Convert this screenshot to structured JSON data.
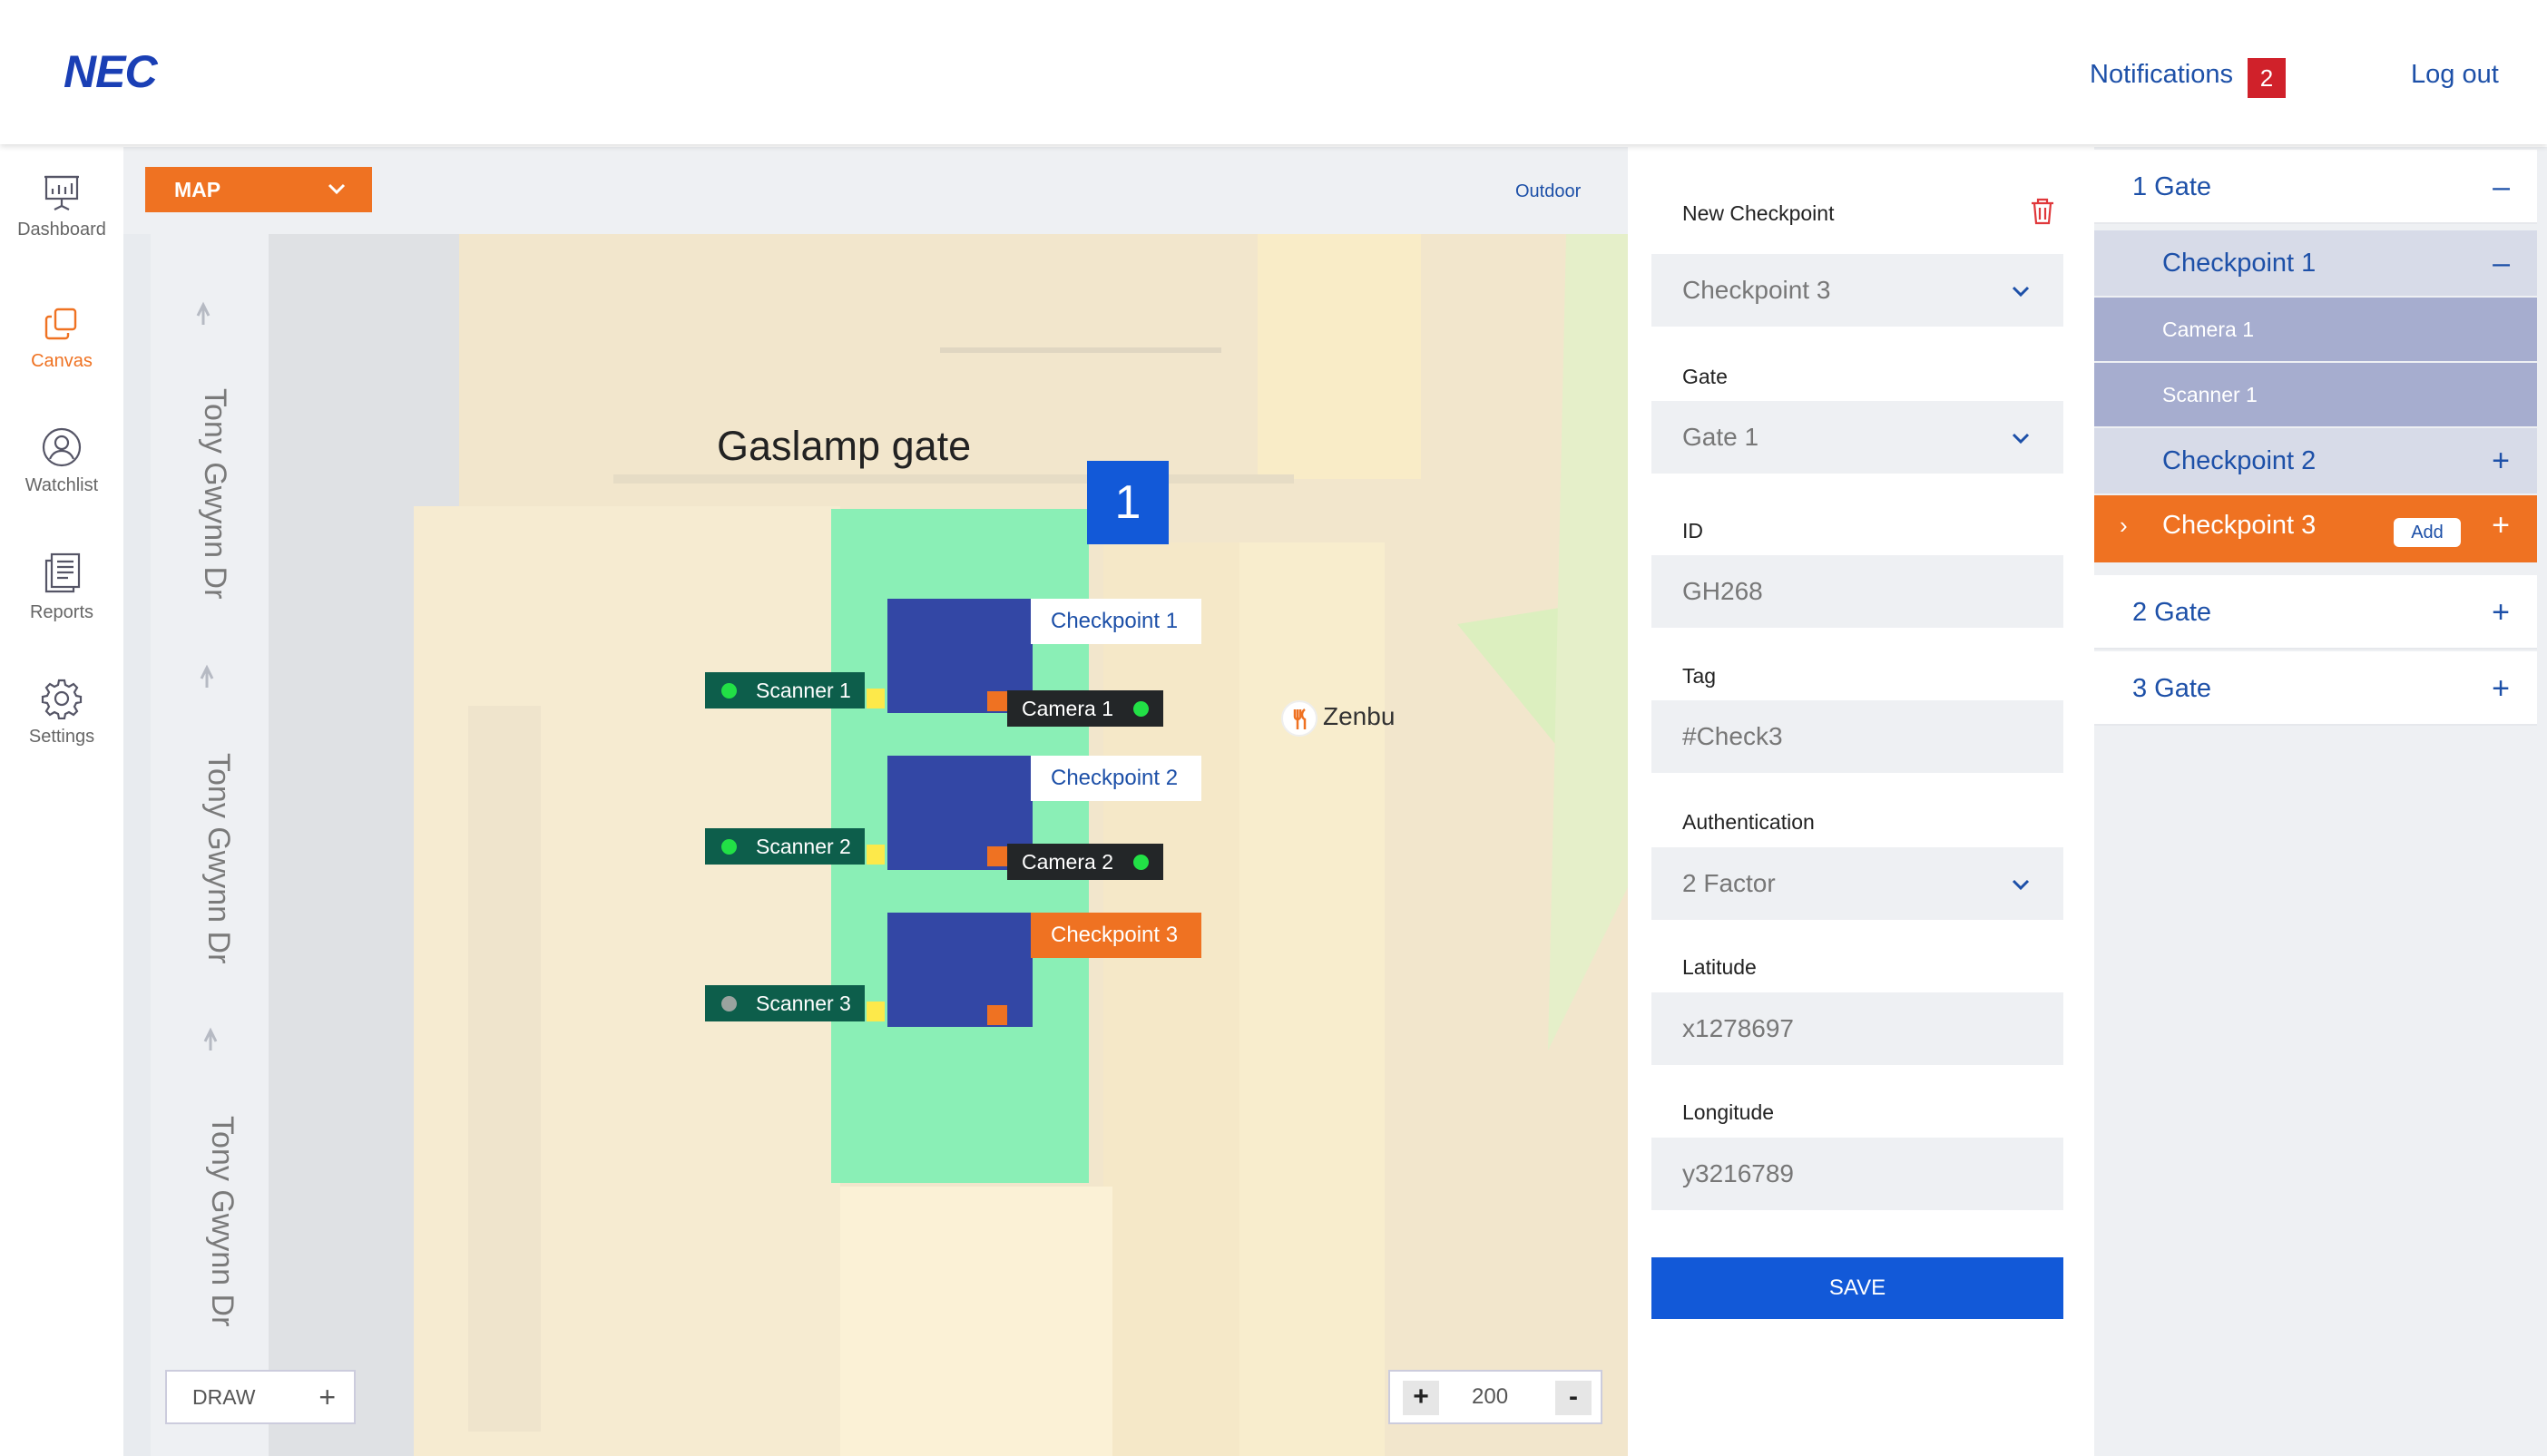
{
  "header": {
    "logo": "NEC",
    "notifications_label": "Notifications",
    "notifications_count": "2",
    "logout_label": "Log out"
  },
  "sidebar": {
    "items": [
      {
        "label": "Dashboard",
        "icon": "presentation-icon"
      },
      {
        "label": "Canvas",
        "icon": "canvas-icon"
      },
      {
        "label": "Watchlist",
        "icon": "user-icon"
      },
      {
        "label": "Reports",
        "icon": "reports-icon"
      },
      {
        "label": "Settings",
        "icon": "gear-icon"
      }
    ],
    "active": "Canvas"
  },
  "map_toolbar": {
    "view_select": "MAP",
    "view_mode": "Outdoor"
  },
  "map": {
    "road_label": "Tony Gwynn Dr",
    "gate_title": "Gaslamp gate",
    "gate_number": "1",
    "poi": "Zenbu",
    "checkpoints": [
      "Checkpoint 1",
      "Checkpoint 2",
      "Checkpoint 3"
    ],
    "scanners": [
      "Scanner 1",
      "Scanner 2",
      "Scanner 3"
    ],
    "cameras": [
      "Camera 1",
      "Camera 2"
    ],
    "draw_label": "DRAW",
    "zoom": "200",
    "zoom_in": "+",
    "zoom_out": "-"
  },
  "form": {
    "title": "New Checkpoint",
    "checkpoint": "Checkpoint 3",
    "gate_label": "Gate",
    "gate_value": "Gate 1",
    "id_label": "ID",
    "id_value": "GH268",
    "tag_label": "Tag",
    "tag_value": "#Check3",
    "auth_label": "Authentication",
    "auth_value": "2 Factor",
    "lat_label": "Latitude",
    "lat_value": "x1278697",
    "lon_label": "Longitude",
    "lon_value": "y3216789",
    "save_label": "SAVE"
  },
  "tree": {
    "gate1": "1 Gate",
    "cp1": "Checkpoint 1",
    "cp1_camera": "Camera 1",
    "cp1_scanner": "Scanner 1",
    "cp2": "Checkpoint 2",
    "cp3": "Checkpoint 3",
    "add_label": "Add",
    "gate2": "2 Gate",
    "gate3": "3 Gate"
  },
  "colors": {
    "accent": "#ef7222",
    "primary": "#1d50a8",
    "save": "#1259d8",
    "gate_zone": "#8aefb6",
    "checkpoint_block": "#3347a5",
    "scanner_bg": "#0d5e4b",
    "camera_bg": "#232628"
  }
}
